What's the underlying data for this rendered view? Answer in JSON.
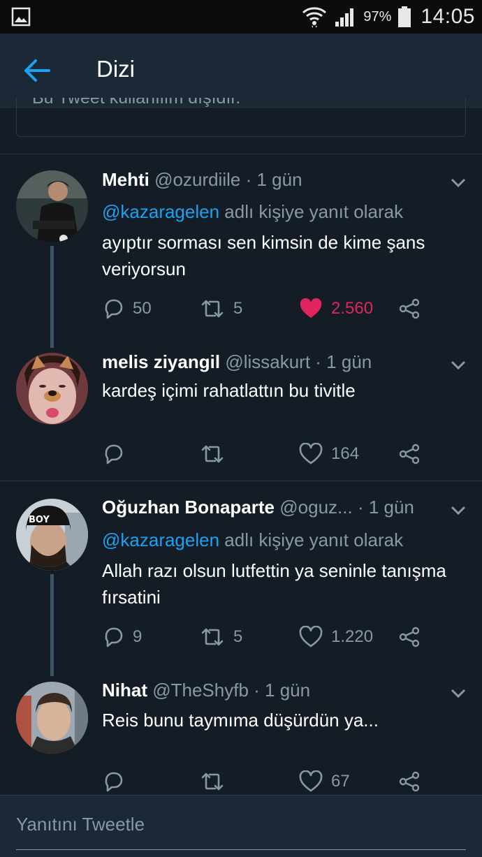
{
  "status_bar": {
    "battery_pct": "97%",
    "time": "14:05"
  },
  "header": {
    "title": "Dizi"
  },
  "hidden_tweet_notice": "Bu Tweet kullanılım dışıdır.",
  "tweets": [
    {
      "name": "Mehti",
      "handle": "@ozurdiile",
      "time": "· 1 gün",
      "reply_mention": "@kazaragelen",
      "reply_text": " adlı kişiye yanıt olarak",
      "body": "ayıptır sorması sen kimsin de kime şans veriyorsun",
      "replies": "50",
      "retweets": "5",
      "likes": "2.560",
      "liked": true
    },
    {
      "name": "melis ziyangil",
      "handle": "@lissakurt",
      "time": "· 1 gün",
      "body": "kardeş içimi rahatlattın bu tivitle",
      "replies": "",
      "retweets": "",
      "likes": "164"
    },
    {
      "name": "Oğuzhan Bonaparte",
      "handle": "@oguz...",
      "time": "· 1 gün",
      "reply_mention": "@kazaragelen",
      "reply_text": " adlı kişiye yanıt olarak",
      "body": "Allah razı olsun lutfettin ya seninle tanışma fırsatini",
      "replies": "9",
      "retweets": "5",
      "likes": "1.220"
    },
    {
      "name": "Nihat",
      "handle": "@TheShyfb",
      "time": "· 1 gün",
      "body": "Reis bunu taymıma düşürdün ya...",
      "replies": "",
      "retweets": "",
      "likes": "67"
    }
  ],
  "reply_bar": {
    "placeholder": "Yanıtını Tweetle"
  },
  "colors": {
    "accent": "#1da1f2",
    "like": "#e0245e",
    "muted": "#8899a6",
    "background": "#141d26"
  }
}
